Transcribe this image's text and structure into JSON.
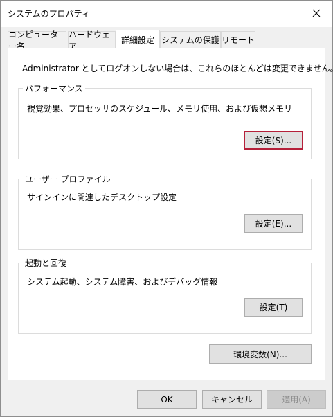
{
  "window": {
    "title": "システムのプロパティ",
    "close_icon": "close-icon"
  },
  "tabs": [
    {
      "label": "コンピューター名",
      "selected": false
    },
    {
      "label": "ハードウェア",
      "selected": false
    },
    {
      "label": "詳細設定",
      "selected": true
    },
    {
      "label": "システムの保護",
      "selected": false
    },
    {
      "label": "リモート",
      "selected": false
    }
  ],
  "notice": "Administrator としてログオンしない場合は、これらのほとんどは変更できません。",
  "performance": {
    "label": "パフォーマンス",
    "description": "視覚効果、プロセッサのスケジュール、メモリ使用、および仮想メモリ",
    "button": "設定(S)..."
  },
  "user_profile": {
    "label": "ユーザー プロファイル",
    "description": "サインインに関連したデスクトップ設定",
    "button": "設定(E)..."
  },
  "startup": {
    "label": "起動と回復",
    "description": "システム起動、システム障害、およびデバッグ情報",
    "button": "設定(T)"
  },
  "env_button": "環境変数(N)...",
  "footer": {
    "ok": "OK",
    "cancel": "キャンセル",
    "apply": "適用(A)"
  },
  "colors": {
    "focus_border": "#b5203a",
    "dialog_bg": "#f0f0f0",
    "panel_bg": "#ffffff"
  }
}
